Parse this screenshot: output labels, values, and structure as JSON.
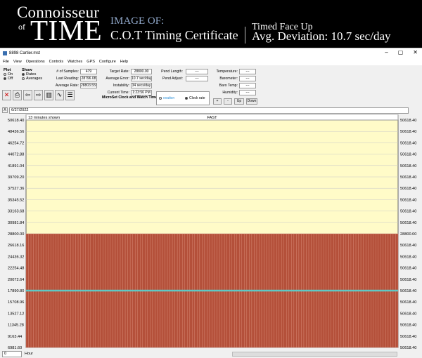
{
  "banner": {
    "brand_top": "Connoisseur",
    "brand_of": "of",
    "brand_time": "TIME",
    "image_of": "IMAGE OF:",
    "cert_title": "C.O.T Timing Certificate",
    "face_up": "Timed Face Up",
    "avg_deviation": "Avg. Deviation: 10.7 sec/day"
  },
  "window": {
    "title": "8898 Cartier.mst",
    "controls": [
      "–",
      "▢",
      "✕"
    ]
  },
  "menu": [
    "File",
    "View",
    "Operations",
    "Controls",
    "Watches",
    "GPS",
    "Configure",
    "Help"
  ],
  "plot": {
    "label": "Plot",
    "on": "On",
    "off": "Off"
  },
  "show": {
    "label": "Show",
    "rates": "Rates",
    "averages": "Averages"
  },
  "stats": {
    "samples_label": "# of Samples:",
    "samples": "479",
    "last_reading_label": "Last Reading:",
    "last_reading": "28796.08",
    "average_rate_label": "Average Rate:",
    "average_rate": "28803.559"
  },
  "targets": {
    "target_rate_label": "Target Rate:",
    "target_rate": "28800.00",
    "avg_error_label": "Average Error:",
    "avg_error": "10.7 sec/day",
    "instability_label": "Instability:",
    "instability": "34 secs/day",
    "current_time_label": "Current Time:",
    "current_time": "1:23:56 PM"
  },
  "pend": {
    "length_label": "Pend Length:",
    "length": "---",
    "adjust_label": "Pend Adjust:",
    "adjust": "---"
  },
  "env": {
    "temperature_label": "Temperature:",
    "temperature": "---",
    "barometer_label": "Barometer:",
    "barometer": "---",
    "baro_temp_label": "Baro Temp:",
    "baro_temp": "---",
    "humidity_label": "Humidity:",
    "humidity": "---"
  },
  "nav": {
    "plus": "+",
    "minus": "-",
    "up": "Up",
    "down": "Down"
  },
  "microset": {
    "label": "MicroSet Clock and Watch Timer",
    "opt1": "ovation",
    "opt2": "Clock rate"
  },
  "date": {
    "close": "X",
    "value": "6/27/2022"
  },
  "chart_data": {
    "type": "area",
    "header_left": "13 minutes shown",
    "header_center": "FAST",
    "y_ticks": [
      "50618.40",
      "48436.56",
      "46254.72",
      "44072.88",
      "41891.04",
      "39709.20",
      "37527.36",
      "35345.52",
      "33163.68",
      "30981.84",
      "28800.00",
      "26618.16",
      "24436.32",
      "22254.48",
      "20072.64",
      "17890.80",
      "15708.96",
      "13527.12",
      "11345.28",
      "9163.44",
      "6981.60"
    ],
    "right_ticks": [
      "50618.40",
      "50618.40",
      "50618.40",
      "50618.40",
      "50618.40",
      "50618.40",
      "50618.40",
      "50618.40",
      "50618.40",
      "50618.40",
      "28800.00",
      "50618.40",
      "50618.40",
      "50618.40",
      "50618.40",
      "50618.40",
      "50618.40",
      "50618.40",
      "50618.40",
      "50618.40",
      "50618.40"
    ],
    "ylim": [
      6981.6,
      50618.4
    ],
    "target_rate": 28800.0,
    "average_line": 17890.8,
    "bar_count": 150,
    "colors": {
      "fast_bg": "#fffbc8",
      "bars": "#b4503a",
      "bar_stroke": "#d88a76",
      "average_line": "#5fc8c4",
      "grid": "#c8c8c8"
    }
  },
  "statusbar": {
    "value": "0",
    "unit": "Hour"
  }
}
